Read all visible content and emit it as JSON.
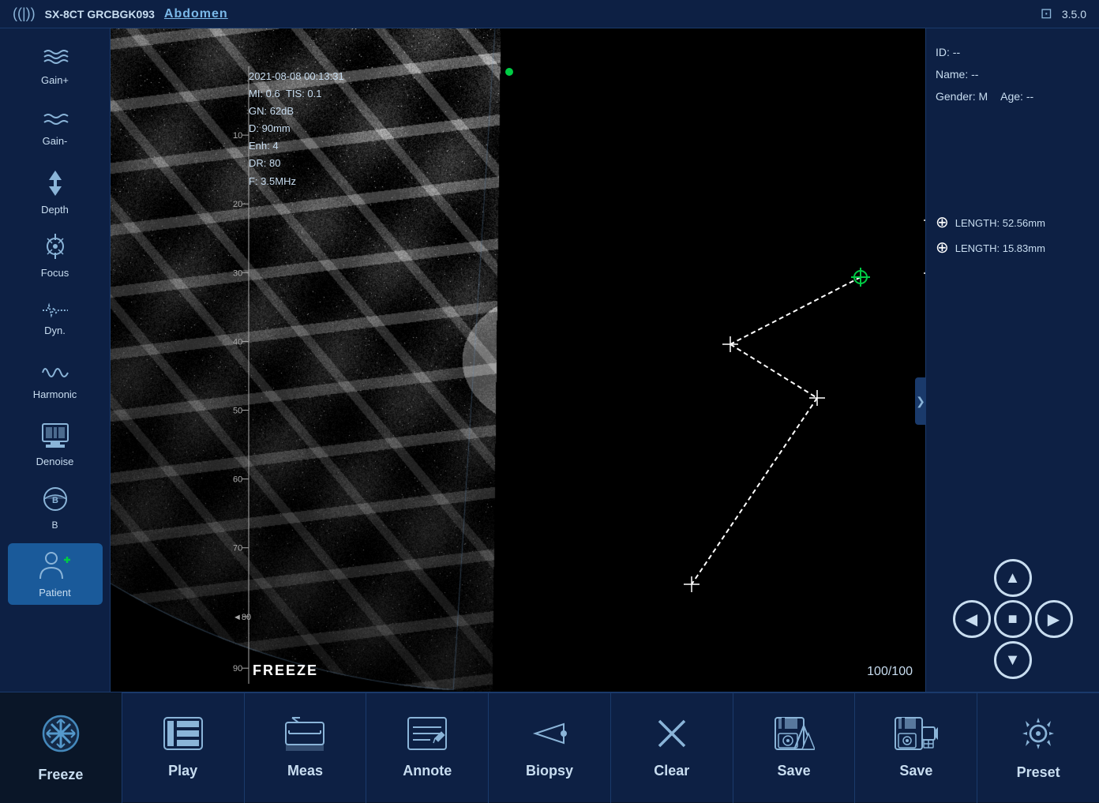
{
  "topbar": {
    "signal_icon": "((|))",
    "device": "SX-8CT GRCBGK093",
    "mode": "Abdomen",
    "version": "3.5.0"
  },
  "sidebar": {
    "items": [
      {
        "id": "gain-plus",
        "label": "Gain+",
        "icon": "≋"
      },
      {
        "id": "gain-minus",
        "label": "Gain-",
        "icon": "≡"
      },
      {
        "id": "depth",
        "label": "Depth",
        "icon": "↑"
      },
      {
        "id": "focus",
        "label": "Focus",
        "icon": "⦿"
      },
      {
        "id": "dyn",
        "label": "Dyn.",
        "icon": "∿"
      },
      {
        "id": "harmonic",
        "label": "Harmonic",
        "icon": "∿∿"
      },
      {
        "id": "denoise",
        "label": "Denoise",
        "icon": "▭"
      },
      {
        "id": "b-mode",
        "label": "B",
        "icon": "◔"
      },
      {
        "id": "patient",
        "label": "Patient",
        "icon": "👤"
      }
    ]
  },
  "overlay": {
    "datetime": "2021-08-08 00:13:31",
    "mi": "MI: 0.6",
    "tis": "TIS: 0.1",
    "gn": "GN: 62dB",
    "d": "D: 90mm",
    "enh": "Enh: 4",
    "dr": "DR: 80",
    "f": "F: 3.5MHz"
  },
  "patient": {
    "id": "ID: --",
    "name": "Name: --",
    "gender": "Gender: M",
    "age": "Age: --"
  },
  "measurements": [
    {
      "label": "LENGTH: 52.56mm",
      "type": "white"
    },
    {
      "label": "LENGTH: 15.83mm",
      "type": "white"
    }
  ],
  "image_info": {
    "freeze_label": "FREEZE",
    "frame_counter": "100/100"
  },
  "depth_marks": [
    {
      "value": "10"
    },
    {
      "value": "20"
    },
    {
      "value": "30"
    },
    {
      "value": "40"
    },
    {
      "value": "50"
    },
    {
      "value": "60"
    },
    {
      "value": "70"
    },
    {
      "value": "80"
    },
    {
      "value": "90"
    }
  ],
  "bottom_bar": {
    "buttons": [
      {
        "id": "freeze",
        "label": "Freeze",
        "icon": "❄"
      },
      {
        "id": "play",
        "label": "Play",
        "icon": "⊞"
      },
      {
        "id": "meas",
        "label": "Meas",
        "icon": "📐"
      },
      {
        "id": "annote",
        "label": "Annote",
        "icon": "✎"
      },
      {
        "id": "biopsy",
        "label": "Biopsy",
        "icon": "⊳"
      },
      {
        "id": "clear",
        "label": "Clear",
        "icon": "✕"
      },
      {
        "id": "save1",
        "label": "Save",
        "icon": "💾"
      },
      {
        "id": "save2",
        "label": "Save",
        "icon": "💾"
      },
      {
        "id": "preset",
        "label": "Preset",
        "icon": "⚙"
      }
    ]
  }
}
